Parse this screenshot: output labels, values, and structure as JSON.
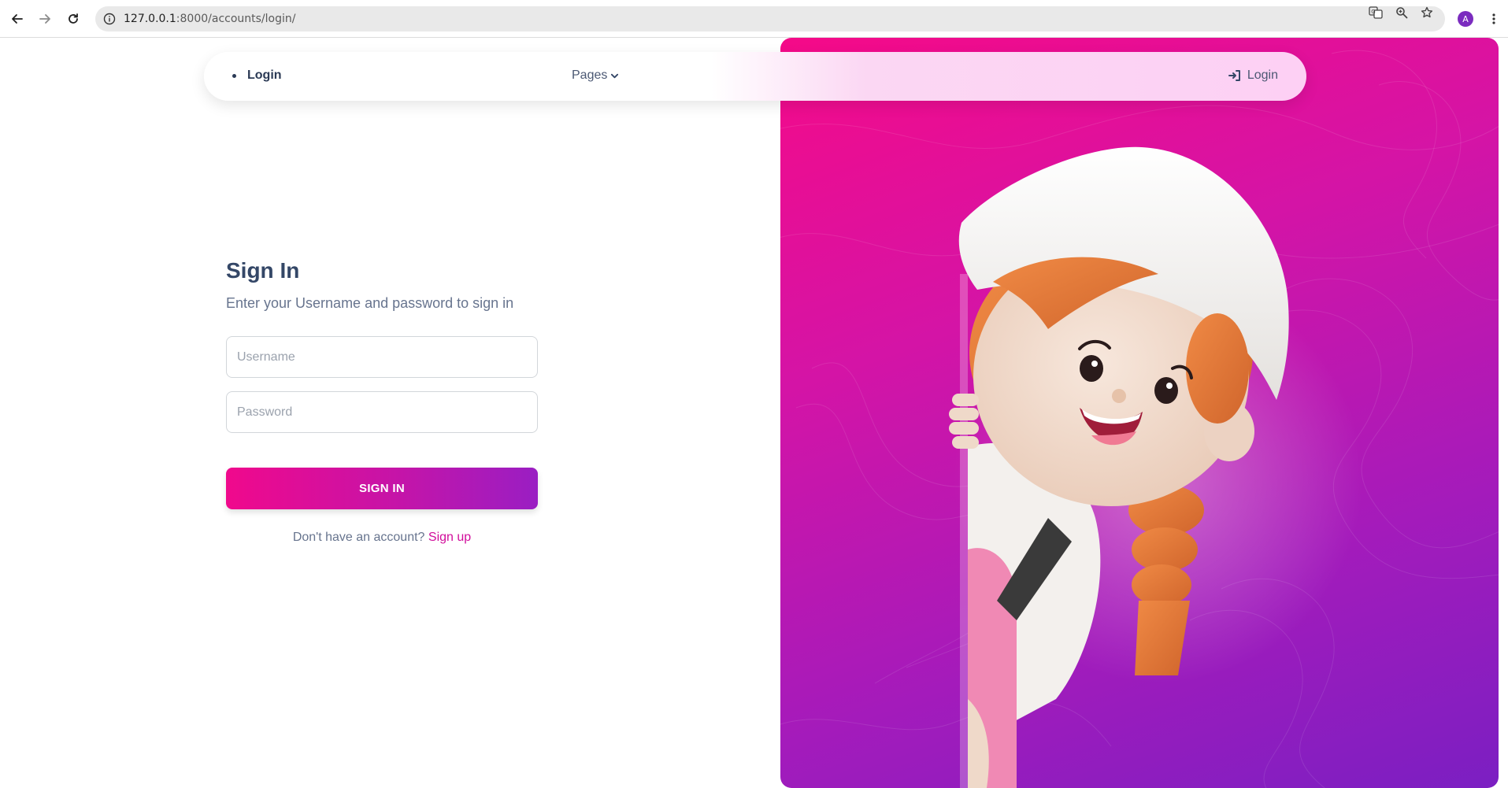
{
  "browser": {
    "url_host": "127.0.0.1",
    "url_rest": ":8000/accounts/login/",
    "profile_initial": "A"
  },
  "navbar": {
    "brand": "Login",
    "pages_label": "Pages",
    "login_label": "Login"
  },
  "signin": {
    "title": "Sign In",
    "subtitle": "Enter your Username and password to sign in",
    "username_placeholder": "Username",
    "username_value": "",
    "password_placeholder": "Password",
    "password_value": "",
    "button_label": "SIGN IN",
    "signup_prompt": "Don't have an account?",
    "signup_link": "Sign up"
  },
  "colors": {
    "primary_gradient_start": "#f0098c",
    "primary_gradient_end": "#9a1ec3",
    "heading": "#344767",
    "text_muted": "#67748e",
    "link": "#d10d9b"
  },
  "icons": {
    "back": "arrow-left-icon",
    "forward": "arrow-right-icon",
    "reload": "reload-icon",
    "site_info": "info-icon",
    "translate": "translate-icon",
    "zoom": "zoom-icon",
    "bookmark": "star-icon",
    "menu": "more-vertical-icon",
    "pages_chevron": "chevron-down-icon",
    "login": "sign-in-icon"
  },
  "hero": {
    "illustration": "3D cartoon girl with white cap and orange braided hair peeking from the side"
  }
}
